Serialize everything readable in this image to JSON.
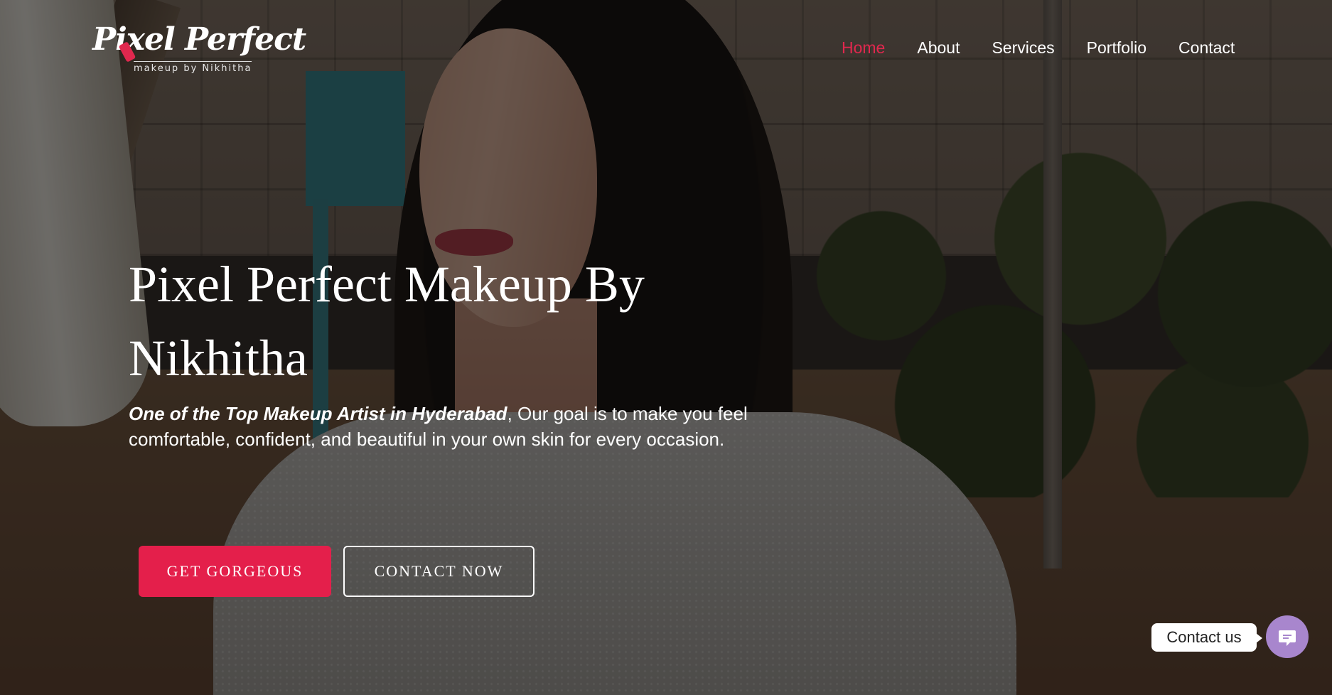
{
  "brand": {
    "logo_text": "Pixel Perfect",
    "logo_subtitle": "makeup by Nikhitha",
    "accent_color": "#e41f4b"
  },
  "nav": {
    "items": [
      {
        "label": "Home",
        "active": true
      },
      {
        "label": "About",
        "active": false
      },
      {
        "label": "Services",
        "active": false
      },
      {
        "label": "Portfolio",
        "active": false
      },
      {
        "label": "Contact",
        "active": false
      }
    ]
  },
  "hero": {
    "title": "Pixel Perfect Makeup By Nikhitha",
    "subtitle_emphasis": "One of the Top Makeup Artist in Hyderabad",
    "subtitle_rest": ", Our goal is to make you feel comfortable, confident, and beautiful in your own skin for every occasion.",
    "primary_button": "GET GORGEOUS",
    "secondary_button": "CONTACT NOW"
  },
  "chat_widget": {
    "label": "Contact us",
    "icon": "chat-icon",
    "color": "#a886cd"
  }
}
